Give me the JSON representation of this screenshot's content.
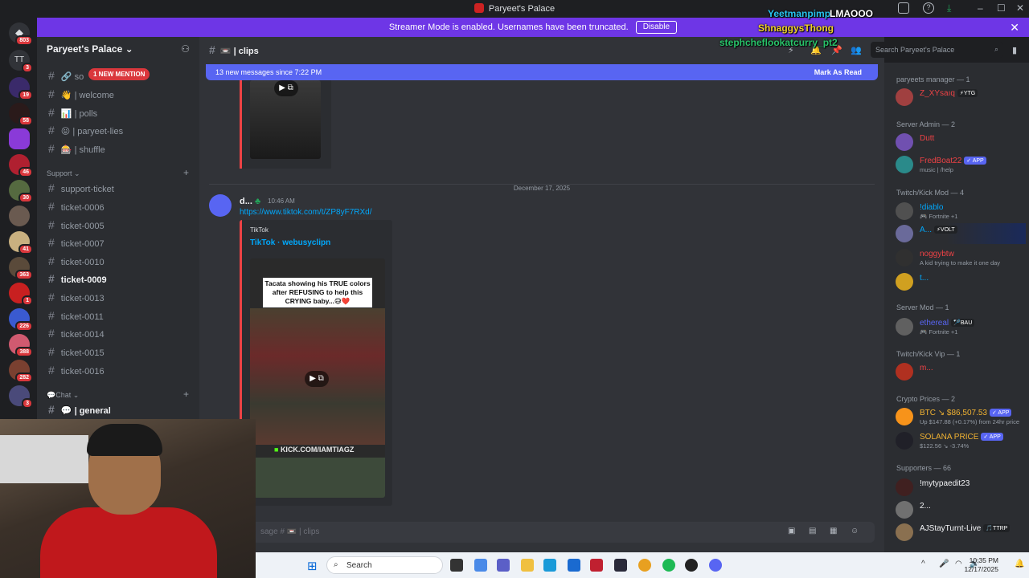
{
  "window": {
    "title": "Paryeet's Palace"
  },
  "banner": {
    "text": "Streamer Mode is enabled. Usernames have been truncated.",
    "disable_label": "Disable"
  },
  "guild_badges": [
    "803",
    "3",
    "19",
    "58",
    "46",
    "30",
    "41",
    "363",
    "1",
    "226",
    "388",
    "282",
    "3"
  ],
  "guild_tt": "TT",
  "sidebar": {
    "server_name": "Paryeet's Palace",
    "mention_pill": "1 NEW MENTION",
    "top_channels": [
      {
        "label": "so",
        "icon": "link-icon"
      },
      {
        "label": "| welcome",
        "icon": "wave-emoji-icon"
      },
      {
        "label": "| polls",
        "icon": "chart-emoji-icon"
      },
      {
        "label": "| paryeet-lies",
        "icon": "face-emoji-icon"
      },
      {
        "label": "| shuffle",
        "icon": "shuffle-emoji-icon"
      }
    ],
    "support_category": "Support",
    "support_channels": [
      "support-ticket",
      "ticket-0006",
      "ticket-0005",
      "ticket-0007",
      "ticket-0010",
      "ticket-0009",
      "ticket-0013",
      "ticket-0011",
      "ticket-0014",
      "ticket-0015",
      "ticket-0016"
    ],
    "active_channel": "ticket-0009",
    "chat_category": "Chat",
    "chat_channels": [
      "| general"
    ]
  },
  "header": {
    "channel": "| clips",
    "search_placeholder": "Search Paryeet's Palace"
  },
  "new_messages": {
    "text": "13 new messages since 7:22 PM",
    "mark_read": "Mark As Read"
  },
  "date_divider": "December 17, 2025",
  "message": {
    "author": "d...",
    "time": "10:46 AM",
    "link": "https://www.tiktok.com/t/ZP8yF7RXd/",
    "embed_provider": "TikTok",
    "embed_title": "TikTok · webusyclipn",
    "video_caption": "Tacata showing his TRUE colors after REFUSING to help this CRYING baby...😅❤️",
    "video_watermark": "KICK.COM/IAMTIAGZ"
  },
  "composer": {
    "placeholder": "sage # 📼 | clips"
  },
  "members": [
    {
      "category": "paryeets manager — 1",
      "rows": [
        {
          "name": "Z_XYsaıq",
          "color": "#ed4245",
          "tag": "⚡YTG",
          "sub": ""
        }
      ]
    },
    {
      "category": "Server Admin — 2",
      "rows": [
        {
          "name": "Dutt",
          "color": "#ed4245",
          "tag": "",
          "sub": ""
        },
        {
          "name": "FredBoat22",
          "color": "#ed4245",
          "tag": "✓ APP",
          "sub": "music | /help"
        }
      ]
    },
    {
      "category": "Twitch/Kick Mod — 4",
      "rows": [
        {
          "name": "!diablo",
          "color": "#00a8fc",
          "tag": "",
          "sub": "🎮 Fortnite +1"
        },
        {
          "name": "A...",
          "color": "#00a8fc",
          "tag": "⚡VOLT",
          "sub": ""
        },
        {
          "name": "noggybtw",
          "color": "#ed4245",
          "tag": "",
          "sub": "A kid trying to make it one day"
        },
        {
          "name": "t...",
          "color": "#00a8fc",
          "tag": "",
          "sub": ""
        }
      ]
    },
    {
      "category": "Server Mod — 1",
      "rows": [
        {
          "name": "ethereal",
          "color": "#5865f2",
          "tag": "🏸BAU",
          "sub": "🎮 Fortnite +1"
        }
      ]
    },
    {
      "category": "Twitch/Kick Vip — 1",
      "rows": [
        {
          "name": "m...",
          "color": "#ed4245",
          "tag": "",
          "sub": ""
        }
      ]
    },
    {
      "category": "Crypto Prices — 2",
      "rows": [
        {
          "name": "BTC ↘ $86,507.53",
          "color": "#f0b232",
          "tag": "✓ APP",
          "sub": "Up $147.88 (+0.17%) from 24hr price"
        },
        {
          "name": "SOLANA PRICE",
          "color": "#f0b232",
          "tag": "✓ APP",
          "sub": "$122.56 ↘ -3.74%"
        }
      ]
    },
    {
      "category": "Supporters — 66",
      "rows": [
        {
          "name": "!mytypaedit23",
          "color": "#f2f3f5",
          "tag": "",
          "sub": ""
        },
        {
          "name": "2...",
          "color": "#f2f3f5",
          "tag": "",
          "sub": ""
        },
        {
          "name": "AJStayTurnt-Live",
          "color": "#f2f3f5",
          "tag": "🎵TTRP",
          "sub": ""
        }
      ]
    }
  ],
  "overlay_chat": [
    {
      "text": "Yeetmanpimp",
      "color": "#28c4f0"
    },
    {
      "text": "LMAOOO",
      "color": "#ffffff"
    },
    {
      "text": "ShnaggysThong",
      "color": "#f0d028"
    },
    {
      "text": "stephcheflookatcurry_pt2",
      "color": "#28c46a"
    }
  ],
  "taskbar": {
    "search": "Search",
    "time": "10:35 PM",
    "date": "12/17/2025"
  }
}
